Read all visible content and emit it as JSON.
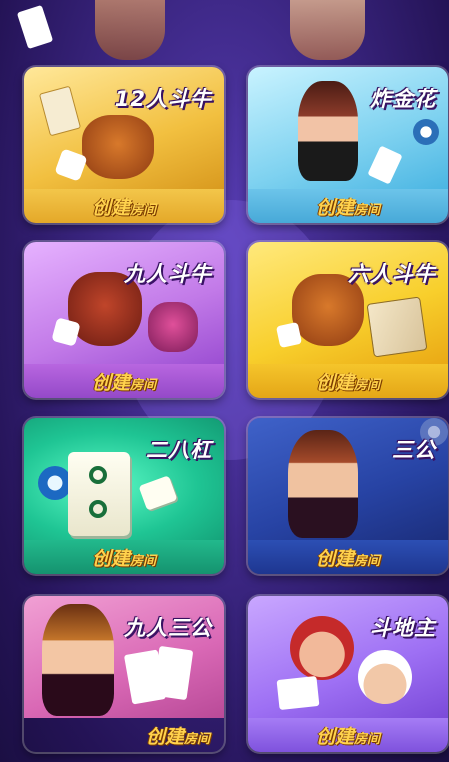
{
  "games": [
    {
      "title": "12人斗牛",
      "action": "创建",
      "action_small": "房间",
      "theme": "gold",
      "art": "bull-mascot-icon"
    },
    {
      "title": "炸金花",
      "action": "创建",
      "action_small": "房间",
      "theme": "blue",
      "art": "woman-dealer-icon"
    },
    {
      "title": "九人斗牛",
      "action": "创建",
      "action_small": "房间",
      "theme": "purple",
      "art": "bull-mascot-icon"
    },
    {
      "title": "六人斗牛",
      "action": "创建",
      "action_small": "房间",
      "theme": "yellow",
      "art": "bull-mascot-icon"
    },
    {
      "title": "二八杠",
      "action": "创建",
      "action_small": "房间",
      "theme": "green",
      "art": "mahjong-tile-icon"
    },
    {
      "title": "三公",
      "action": "创建",
      "action_small": "房间",
      "theme": "navy",
      "art": "woman-dealer-icon"
    },
    {
      "title": "九人三公",
      "action": "创建",
      "action_small": "房间",
      "theme": "magenta",
      "art": "woman-dealer-icon"
    },
    {
      "title": "斗地主",
      "action": "创建",
      "action_small": "房间",
      "theme": "violet",
      "art": "cartoon-men-icon"
    }
  ]
}
